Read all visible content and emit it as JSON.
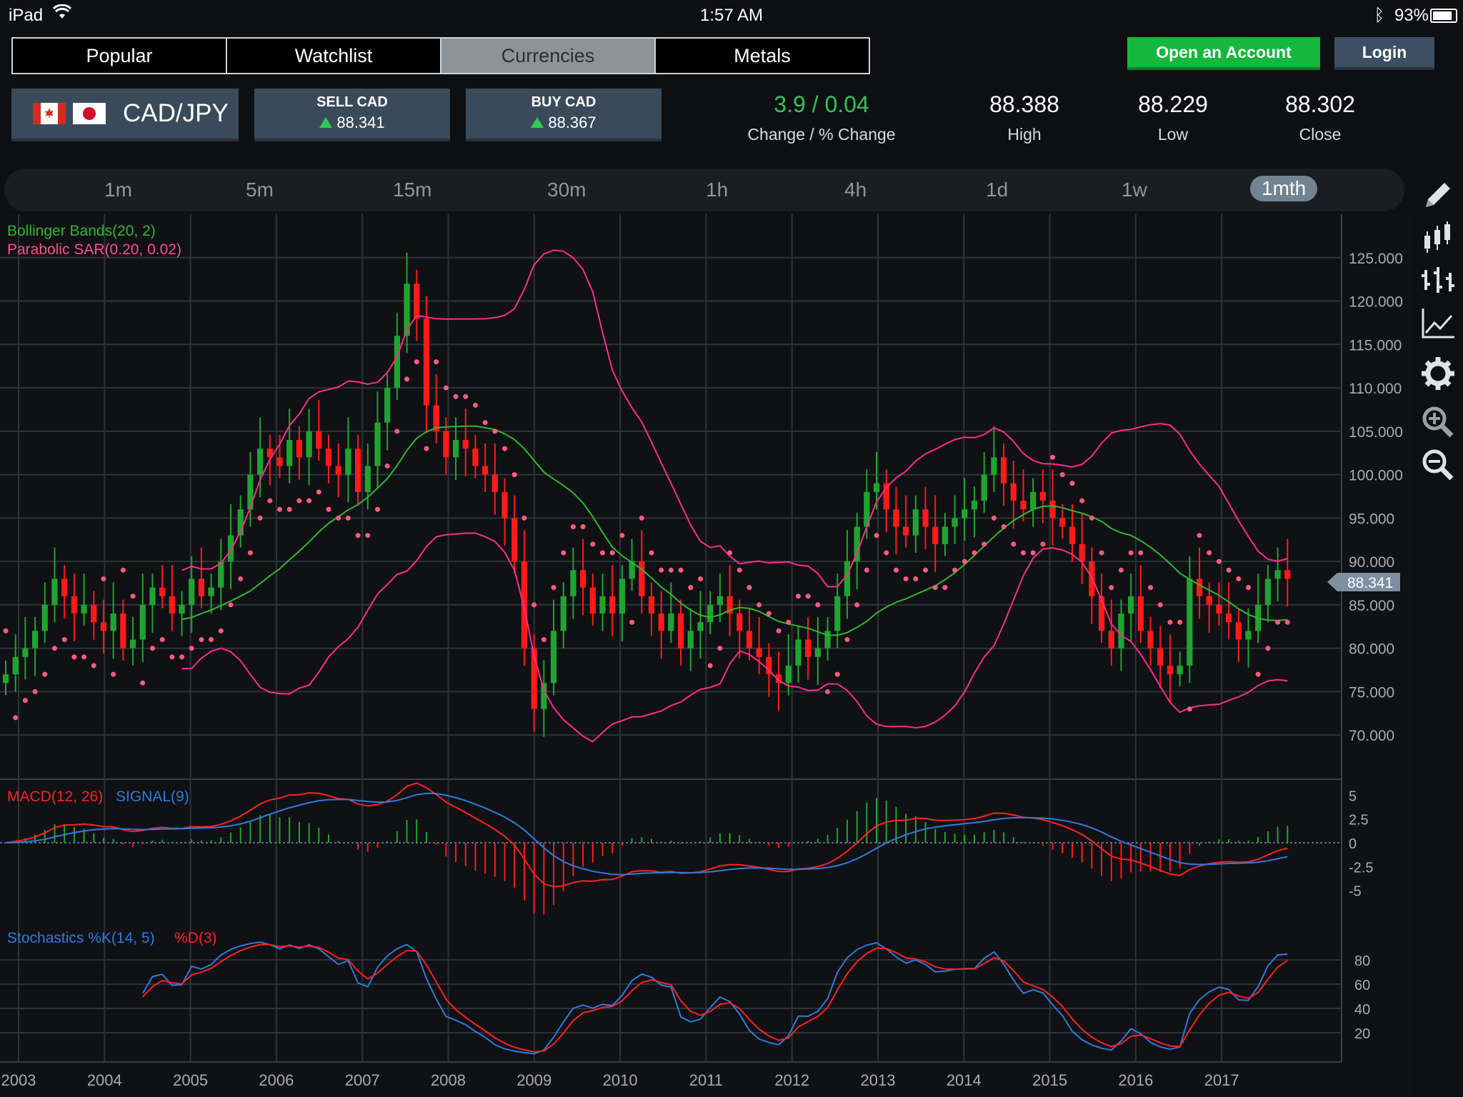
{
  "status": {
    "carrier": "iPad",
    "time": "1:57 AM",
    "battery": "93%"
  },
  "tabs": [
    {
      "label": "Popular",
      "active": false
    },
    {
      "label": "Watchlist",
      "active": false
    },
    {
      "label": "Currencies",
      "active": true
    },
    {
      "label": "Metals",
      "active": false
    }
  ],
  "actions": {
    "open_account": "Open an Account",
    "login": "Login"
  },
  "instrument": {
    "pair": "CAD/JPY",
    "sell_label": "SELL CAD",
    "sell_price": "88.341",
    "buy_label": "BUY CAD",
    "buy_price": "88.367"
  },
  "stats": {
    "change": "3.9 / 0.04",
    "change_label": "Change / % Change",
    "high": "88.388",
    "high_label": "High",
    "low": "88.229",
    "low_label": "Low",
    "close": "88.302",
    "close_label": "Close"
  },
  "timeframes": [
    "1m",
    "5m",
    "15m",
    "30m",
    "1h",
    "4h",
    "1d",
    "1w",
    "1mth"
  ],
  "active_timeframe": "1mth",
  "side_icons": [
    "pencil-icon",
    "candlestick-icon",
    "ohlc-bars-icon",
    "line-chart-icon",
    "gear-icon",
    "zoom-in-icon",
    "zoom-out-icon"
  ],
  "colors": {
    "up": "#1fa52f",
    "down": "#ff1a1a",
    "bollinger": "#2eb82e",
    "bands": "#ff2b8a",
    "sar": "#ff5b7e",
    "macd": "#ff2020",
    "signal": "#2d7be0",
    "stoch_k": "#2d7be0",
    "stoch_d": "#ff2020"
  },
  "chart_data": {
    "type": "candlestick",
    "years": [
      "2003",
      "2004",
      "2005",
      "2006",
      "2007",
      "2008",
      "2009",
      "2010",
      "2011",
      "2012",
      "2013",
      "2014",
      "2015",
      "2016",
      "2017"
    ],
    "price_axis": [
      "125.000",
      "120.000",
      "115.000",
      "110.000",
      "105.000",
      "100.000",
      "95.000",
      "90.000",
      "85.000",
      "80.000",
      "75.000",
      "70.000"
    ],
    "price_ylim": [
      65,
      130
    ],
    "current_price": "88.341",
    "indicator_labels": {
      "bollinger": "Bollinger Bands(20, 2)",
      "sar": "Parabolic SAR(0.20, 0.02)",
      "macd": "MACD(12, 26)",
      "signal": "SIGNAL(9)",
      "stoch_k": "Stochastics %K(14, 5)",
      "stoch_d": "%D(3)"
    },
    "macd_axis": [
      "5",
      "2.5",
      "0",
      "-2.5",
      "-5"
    ],
    "stoch_axis": [
      "80",
      "60",
      "40",
      "20"
    ],
    "close_series": [
      77,
      79,
      80,
      82,
      85,
      88,
      86,
      84,
      85,
      83,
      82,
      84,
      80,
      81,
      85,
      87,
      86,
      84,
      85,
      88,
      86,
      87,
      90,
      93,
      96,
      100,
      103,
      102,
      101,
      104,
      102,
      105,
      103,
      101,
      100,
      103,
      98,
      101,
      106,
      110,
      116,
      122,
      118,
      108,
      105,
      102,
      104,
      103,
      101,
      100,
      98,
      95,
      90,
      80,
      73,
      76,
      82,
      86,
      89,
      87,
      84,
      86,
      84,
      88,
      90,
      86,
      84,
      82,
      84,
      80,
      82,
      83,
      85,
      86,
      84,
      82,
      80,
      79,
      77,
      76,
      78,
      81,
      79,
      80,
      82,
      86,
      90,
      94,
      98,
      99,
      96,
      94,
      93,
      96,
      94,
      92,
      94,
      95,
      96,
      97,
      100,
      102,
      99,
      97,
      96,
      98,
      97,
      95,
      94,
      92,
      90,
      86,
      82,
      80,
      84,
      86,
      82,
      80,
      78,
      77,
      78,
      88,
      86,
      85,
      84,
      83,
      81,
      82,
      85,
      88,
      89,
      88
    ]
  }
}
